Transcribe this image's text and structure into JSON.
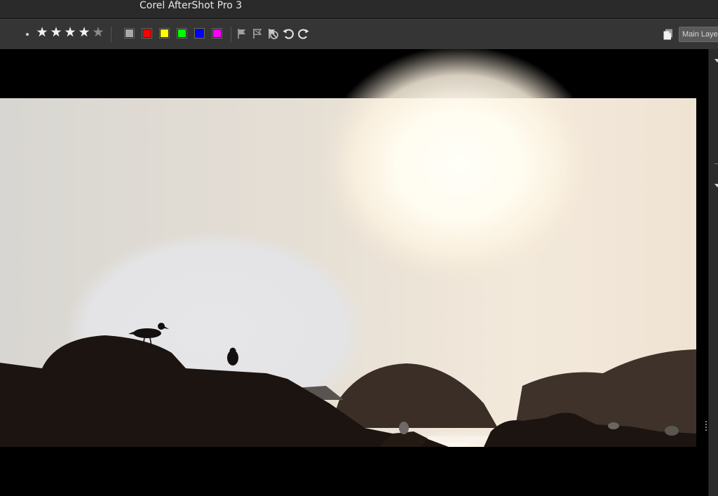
{
  "window": {
    "title": "Corel AfterShot Pro 3"
  },
  "toolbar": {
    "rating": {
      "value": 4,
      "max": 5
    },
    "color_labels": [
      "#a8a8a8",
      "#ff0000",
      "#ffff00",
      "#00ff00",
      "#0000ff",
      "#ff00ff"
    ],
    "tools": [
      "flag-pick-icon",
      "flag-reject-icon",
      "unflag-icon",
      "rotate-left-icon",
      "rotate-right-icon"
    ],
    "layer_select": {
      "value": "Main Layer"
    }
  },
  "viewer": {
    "accent_sky": "#efe6da",
    "accent_sun": "#fffdf6",
    "accent_rocks": "#1c1410"
  }
}
